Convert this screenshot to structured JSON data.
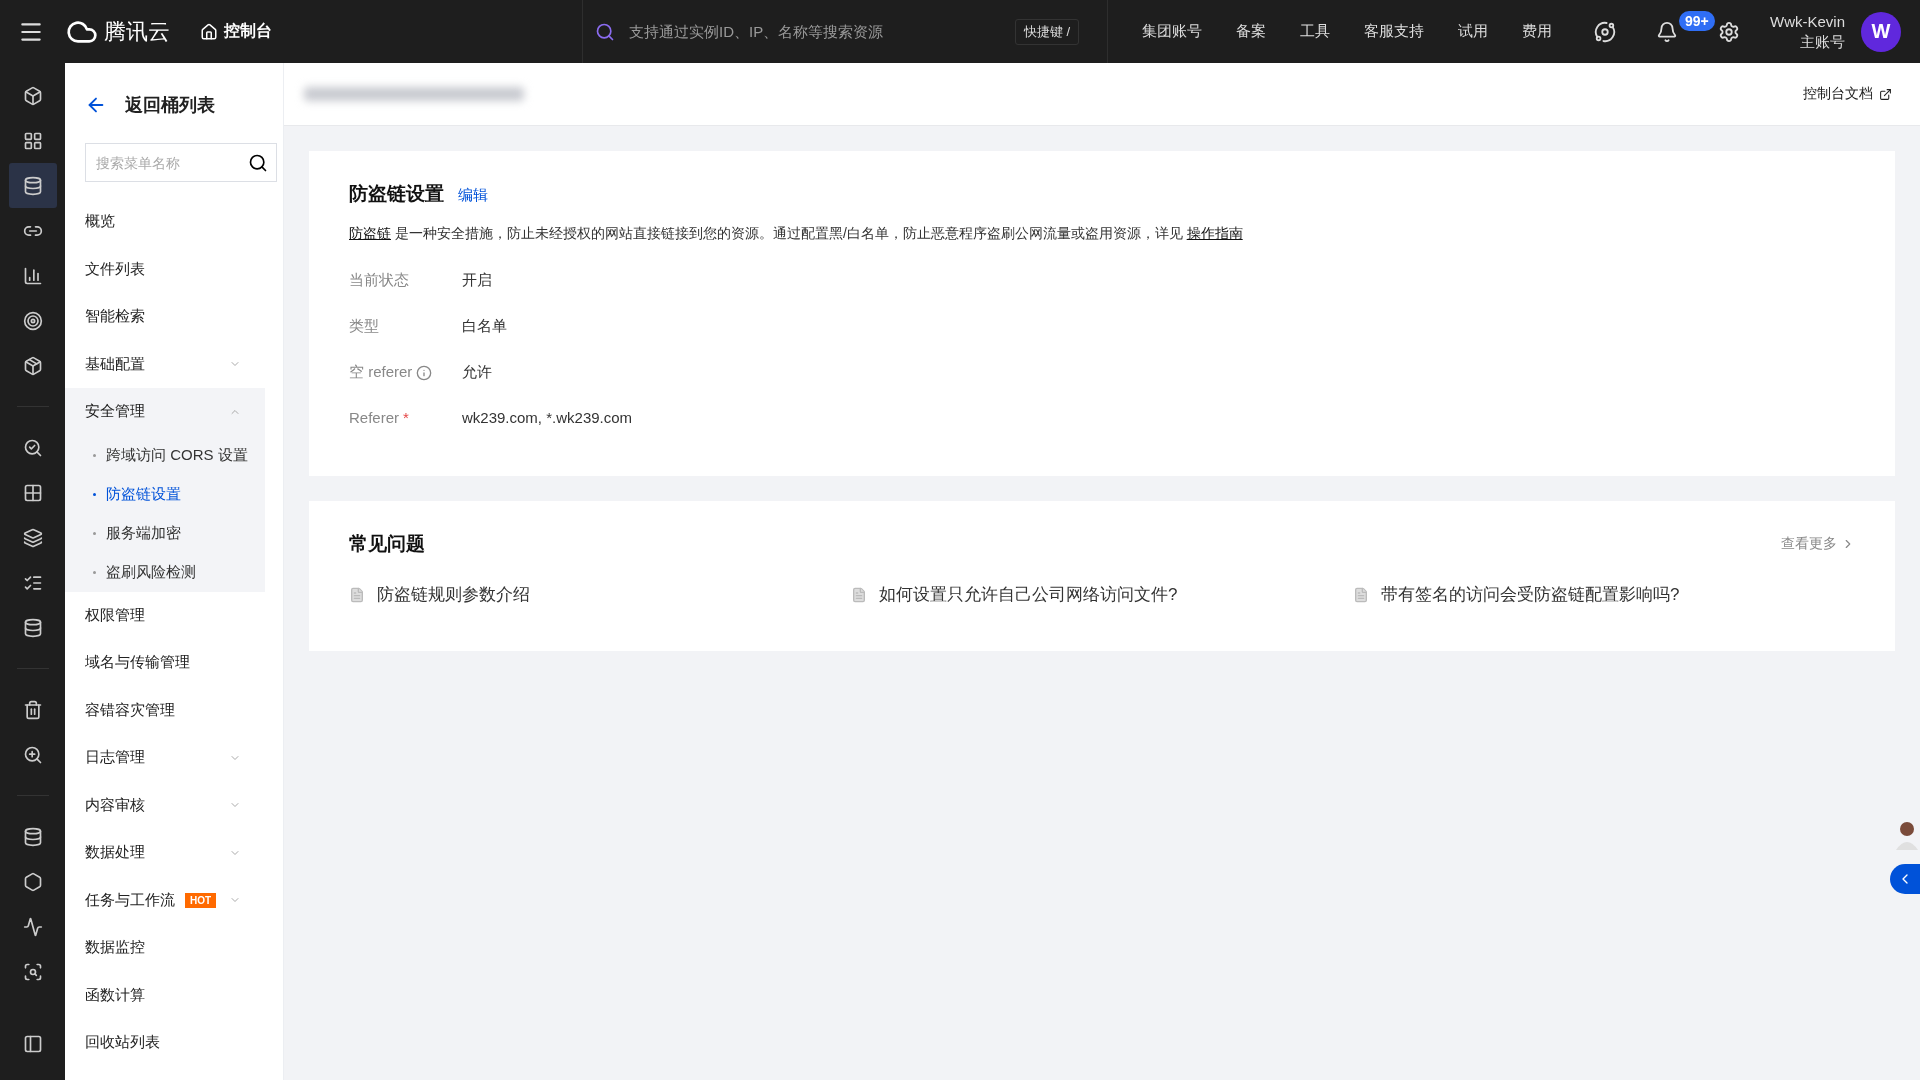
{
  "topbar": {
    "logo": "腾讯云",
    "console": "控制台",
    "search_placeholder": "支持通过实例ID、IP、名称等搜索资源",
    "shortcut": "快捷键 /",
    "nav": [
      "集团账号",
      "备案",
      "工具",
      "客服支持",
      "试用",
      "费用"
    ],
    "badge": "99+",
    "user": "Wwk-Kevin",
    "role": "主账号",
    "avatar": "W"
  },
  "rail": [
    [
      {
        "selected": false
      },
      {
        "selected": false
      },
      {
        "selected": true
      },
      {
        "selected": false
      },
      {
        "selected": false
      },
      {
        "selected": false
      },
      {
        "selected": false
      }
    ],
    [
      {
        "selected": false
      },
      {
        "selected": false
      },
      {
        "selected": false
      },
      {
        "selected": false
      },
      {
        "selected": false
      }
    ],
    [
      {
        "selected": false
      },
      {
        "selected": false
      }
    ],
    [
      {
        "selected": false
      },
      {
        "selected": false
      },
      {
        "selected": false
      },
      {
        "selected": false
      }
    ]
  ],
  "sidebar": {
    "back": "返回桶列表",
    "search_placeholder": "搜索菜单名称",
    "items": [
      {
        "label": "概览"
      },
      {
        "label": "文件列表"
      },
      {
        "label": "智能检索"
      },
      {
        "label": "基础配置",
        "expanded": false
      },
      {
        "label": "安全管理",
        "expanded": true,
        "children": [
          {
            "label": "跨域访问 CORS 设置",
            "selected": false
          },
          {
            "label": "防盗链设置",
            "selected": true
          },
          {
            "label": "服务端加密",
            "selected": false
          },
          {
            "label": "盗刷风险检测",
            "selected": false
          }
        ]
      },
      {
        "label": "权限管理"
      },
      {
        "label": "域名与传输管理"
      },
      {
        "label": "容错容灾管理"
      },
      {
        "label": "日志管理",
        "expanded": false
      },
      {
        "label": "内容审核",
        "expanded": false
      },
      {
        "label": "数据处理",
        "expanded": false
      },
      {
        "label": "任务与工作流",
        "expanded": false,
        "badge": "HOT"
      },
      {
        "label": "数据监控"
      },
      {
        "label": "函数计算"
      },
      {
        "label": "回收站列表"
      }
    ]
  },
  "header": {
    "doc_link": "控制台文档"
  },
  "settings": {
    "title": "防盗链设置",
    "edit": "编辑",
    "intro_link": "防盗链",
    "description": "是一种安全措施，防止未经授权的网站直接链接到您的资源。通过配置黑/白名单，防止恶意程序盗刷公网流量或盗用资源，详见",
    "guide_link": "操作指南",
    "fields": [
      {
        "label": "当前状态",
        "value": "开启"
      },
      {
        "label": "类型",
        "value": "白名单"
      },
      {
        "label": "空 referer",
        "value": "允许",
        "info": true
      },
      {
        "label": "Referer",
        "value": "wk239.com, *.wk239.com",
        "required_mark": "*"
      }
    ]
  },
  "faq": {
    "title": "常见问题",
    "more": "查看更多",
    "items": [
      "防盗链规则参数介绍",
      "如何设置只允许自己公司网络访问文件?",
      "带有签名的访问会受防盗链配置影响吗?"
    ]
  }
}
